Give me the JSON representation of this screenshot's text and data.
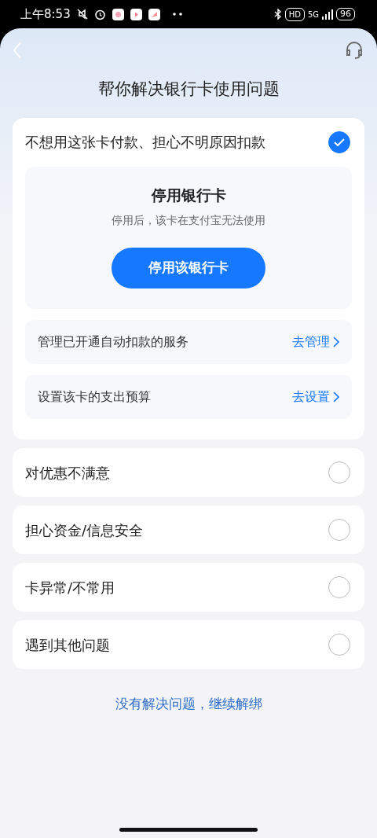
{
  "status_bar": {
    "time": "上午8:53",
    "hd": "HD",
    "network": "5G",
    "battery": "96"
  },
  "header": {
    "title": "帮你解决银行卡使用问题"
  },
  "options": [
    {
      "label": "不想用这张卡付款、担心不明原因扣款",
      "selected": true,
      "detail": {
        "title": "停用银行卡",
        "subtitle": "停用后，该卡在支付宝无法使用",
        "button": "停用该银行卡",
        "links": [
          {
            "label": "管理已开通自动扣款的服务",
            "action": "去管理"
          },
          {
            "label": "设置该卡的支出预算",
            "action": "去设置"
          }
        ]
      }
    },
    {
      "label": "对优惠不满意",
      "selected": false
    },
    {
      "label": "担心资金/信息安全",
      "selected": false
    },
    {
      "label": "卡异常/不常用",
      "selected": false
    },
    {
      "label": "遇到其他问题",
      "selected": false
    }
  ],
  "footer_link": "没有解决问题，继续解绑"
}
